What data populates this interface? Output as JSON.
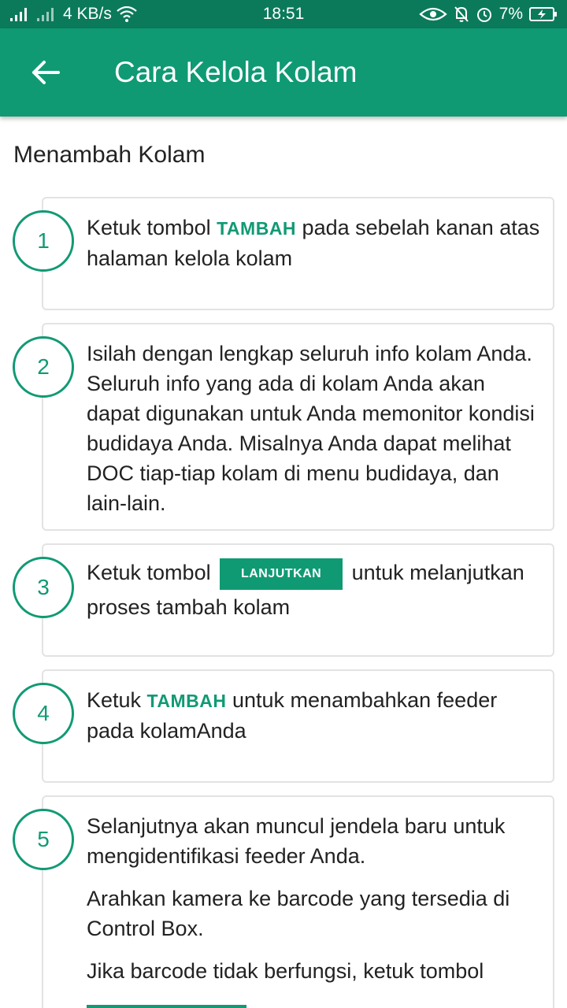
{
  "status_bar": {
    "network_speed": "4 KB/s",
    "time": "18:51",
    "battery": "7%"
  },
  "app_bar": {
    "title": "Cara Kelola Kolam",
    "back_icon": "arrow-left-icon"
  },
  "section_title": "Menambah Kolam",
  "steps": [
    {
      "number": "1",
      "parts": [
        "Ketuk tombol ",
        "TAMBAH",
        " pada sebelah kanan atas halaman kelola kolam"
      ]
    },
    {
      "number": "2",
      "text": "Isilah dengan lengkap seluruh info kolam Anda. Seluruh info yang ada di kolam Anda akan dapat digunakan untuk Anda memonitor kondisi budidaya Anda. Misalnya Anda dapat melihat DOC tiap-tiap kolam di menu budidaya, dan lain-lain."
    },
    {
      "number": "3",
      "parts": [
        "Ketuk tombol ",
        "LANJUTKAN",
        " untuk melanjutkan proses tambah kolam"
      ]
    },
    {
      "number": "4",
      "parts": [
        "Ketuk ",
        "TAMBAH",
        " untuk menambahkan feeder pada kolamAnda"
      ]
    },
    {
      "number": "5",
      "paragraphs": [
        "Selanjutnya akan muncul jendela baru untuk mengidentifikasi feeder Anda.",
        "Arahkan kamera ke barcode yang tersedia di Control Box.",
        "Jika barcode tidak berfungsi, ketuk tombol"
      ]
    }
  ],
  "colors": {
    "status_bar": "#0b7a5a",
    "app_bar": "#0f9a74",
    "accent": "#119a74",
    "card_border": "#e3e3e3"
  }
}
